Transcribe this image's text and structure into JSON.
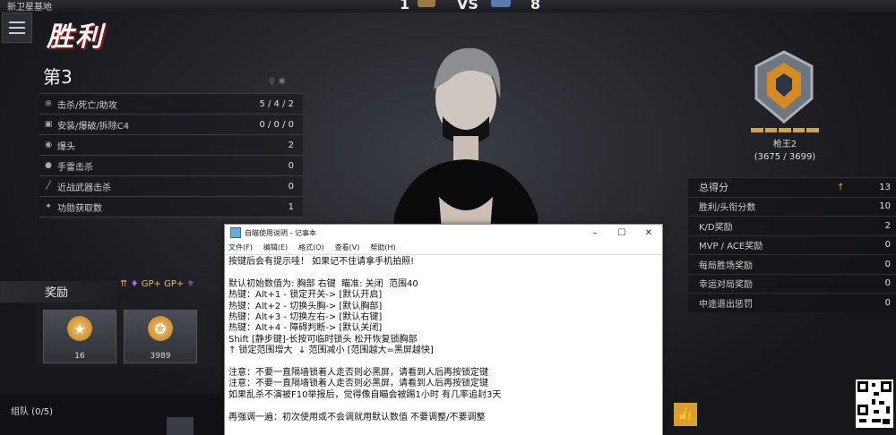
{
  "header": {
    "map_name": "新卫星基地",
    "score_left": "1",
    "vs": "VS",
    "score_right": "8"
  },
  "result": {
    "title": "胜利",
    "rank": "第3"
  },
  "player_stats": [
    {
      "label": "击杀/死亡/助攻",
      "value": "5 / 4 / 2"
    },
    {
      "label": "安装/爆破/拆除C4",
      "value": "0 / 0 / 0"
    },
    {
      "label": "爆头",
      "value": "2"
    },
    {
      "label": "手雷击杀",
      "value": "0"
    },
    {
      "label": "近战武器击杀",
      "value": "0"
    },
    {
      "label": "功勋获取数",
      "value": "1"
    }
  ],
  "rank_info": {
    "name": "枪王2",
    "points": "(3675 / 3699)",
    "progress": 0.99
  },
  "score_summary": [
    {
      "label": "总得分",
      "value": "13",
      "arrow": "↑"
    },
    {
      "label": "胜利/头衔分数",
      "value": "10",
      "arrow": ""
    },
    {
      "label": "K/D奖励",
      "value": "2",
      "arrow": ""
    },
    {
      "label": "MVP / ACE奖励",
      "value": "0",
      "arrow": ""
    },
    {
      "label": "每局胜场奖励",
      "value": "0",
      "arrow": ""
    },
    {
      "label": "幸运对局奖励",
      "value": "0",
      "arrow": ""
    },
    {
      "label": "中途退出惩罚",
      "value": "0",
      "arrow": ""
    }
  ],
  "rewards": {
    "title": "奖励",
    "buff_text": "GP+ GP+",
    "items": [
      {
        "icon": "rank-star-icon",
        "value": "16"
      },
      {
        "icon": "gp-coin-icon",
        "value": "3989"
      }
    ]
  },
  "team": {
    "label": "组队 (0/5)"
  },
  "notepad": {
    "title": "自瞄使用说明 - 记事本",
    "menu": [
      "文件(F)",
      "编辑(E)",
      "格式(O)",
      "查看(V)",
      "帮助(H)"
    ],
    "lines": [
      "按键后会有提示哇！ 如果记不住请拿手机拍照!",
      "",
      "默认初始数值为: 胸部 右键  瞄准: 关闭  范围40",
      "热键：Alt+1 - 锁定开关-> [默认开启]",
      "热键：Alt+2 - 切换头胸-> [默认胸部]",
      "热键：Alt+3 - 切换左右-> [默认右键]",
      "热键：Alt+4 - 障碍判断-> [默认关闭]",
      "Shift [静步键]-长按可临时锁头 松开恢复锁胸部",
      "↑ 锁定范围增大  ↓ 范围减小 [范围越大=黑屏越快]",
      "",
      "注意：不要一直隔墙锁着人走否则必黑屏，请看到人后再按锁定键",
      "注意：不要一直隔墙锁着人走否则必黑屏，请看到人后再按锁定键",
      "如果乱杀不演被F10举报后，觉得像自瞄会被踢1小时 有几率追封3天",
      "",
      "再强调一遍：初次使用或不会调就用默认数值 不要调整/不要调整"
    ]
  }
}
